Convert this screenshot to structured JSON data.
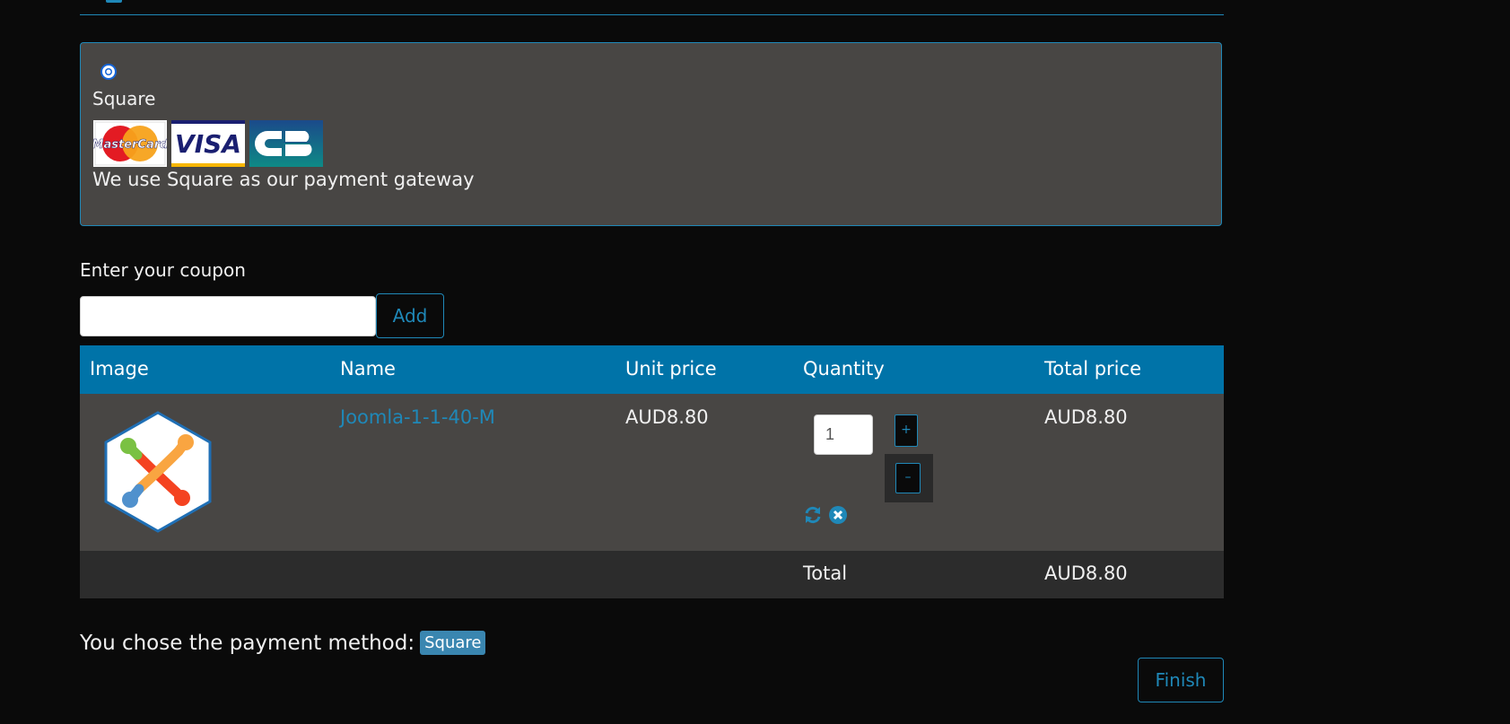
{
  "payment": {
    "method_name": "Square",
    "description": "We use Square as our payment gateway",
    "cards": [
      "mastercard-logo",
      "visa-logo",
      "cb-logo"
    ],
    "selected": true
  },
  "coupon": {
    "label": "Enter your coupon",
    "value": "",
    "add_label": "Add"
  },
  "cart": {
    "headers": [
      "Image",
      "Name",
      "Unit price",
      "Quantity",
      "Total price"
    ],
    "rows": [
      {
        "image_icon": "joomla-logo",
        "name": "Joomla-1-1-40-M",
        "unit_price": "AUD8.80",
        "quantity": "1",
        "plus_label": "+",
        "minus_label": "–",
        "total_price": "AUD8.80"
      }
    ],
    "total_label": "Total",
    "total_value": "AUD8.80"
  },
  "summary": {
    "chosen_text": "You chose the payment method:",
    "chosen_badge": "Square",
    "finish_label": "Finish"
  },
  "colors": {
    "accent": "#1f88b8",
    "header_bg": "#0073a8",
    "panel_bg": "#484644",
    "page_bg": "#0a0a0a"
  }
}
